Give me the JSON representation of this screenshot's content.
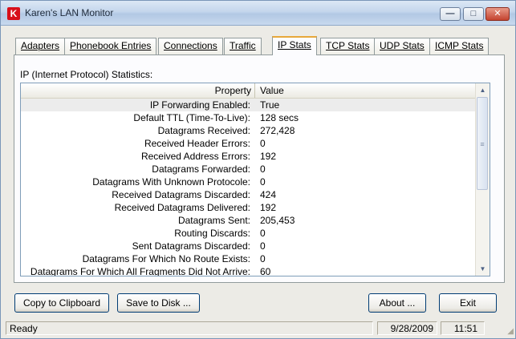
{
  "window": {
    "title": "Karen's LAN Monitor",
    "icon_letter": "K",
    "minimize_label": "—",
    "maximize_label": "□",
    "close_label": "✕"
  },
  "tabs": [
    {
      "label": "Adapters"
    },
    {
      "label": "Phonebook Entries"
    },
    {
      "label": "Connections"
    },
    {
      "label": "Traffic"
    },
    {
      "label": "IP Stats"
    },
    {
      "label": "TCP Stats"
    },
    {
      "label": "UDP Stats"
    },
    {
      "label": "ICMP Stats"
    }
  ],
  "active_tab": "IP Stats",
  "section_label": "IP (Internet Protocol) Statistics:",
  "table": {
    "columns": [
      "Property",
      "Value"
    ],
    "rows": [
      {
        "property": "IP Forwarding Enabled:",
        "value": "True"
      },
      {
        "property": "Default TTL (Time-To-Live):",
        "value": "128 secs"
      },
      {
        "property": "Datagrams Received:",
        "value": "272,428"
      },
      {
        "property": "Received Header Errors:",
        "value": "0"
      },
      {
        "property": "Received Address Errors:",
        "value": "192"
      },
      {
        "property": "Datagrams Forwarded:",
        "value": "0"
      },
      {
        "property": "Datagrams With Unknown Protocole:",
        "value": "0"
      },
      {
        "property": "Received Datagrams Discarded:",
        "value": "424"
      },
      {
        "property": "Received Datagrams Delivered:",
        "value": "192"
      },
      {
        "property": "Datagrams Sent:",
        "value": "205,453"
      },
      {
        "property": "Routing Discards:",
        "value": "0"
      },
      {
        "property": "Sent Datagrams Discarded:",
        "value": "0"
      },
      {
        "property": "Datagrams For Which No Route Exists:",
        "value": "0"
      },
      {
        "property": "Datagrams For Which All Fragments Did Not Arrive:",
        "value": "60"
      }
    ]
  },
  "buttons": {
    "copy": "Copy to Clipboard",
    "save": "Save to Disk ...",
    "about": "About ...",
    "exit": "Exit"
  },
  "status": {
    "text": "Ready",
    "date": "9/28/2009",
    "time": "11:51"
  },
  "scrollbar": {
    "up_icon": "▲",
    "down_icon": "▼",
    "thumb_grip": "≡"
  },
  "colors": {
    "accent_tab": "#e8a83a",
    "brand_icon": "#d8101a",
    "selected_row": "#ececec"
  }
}
